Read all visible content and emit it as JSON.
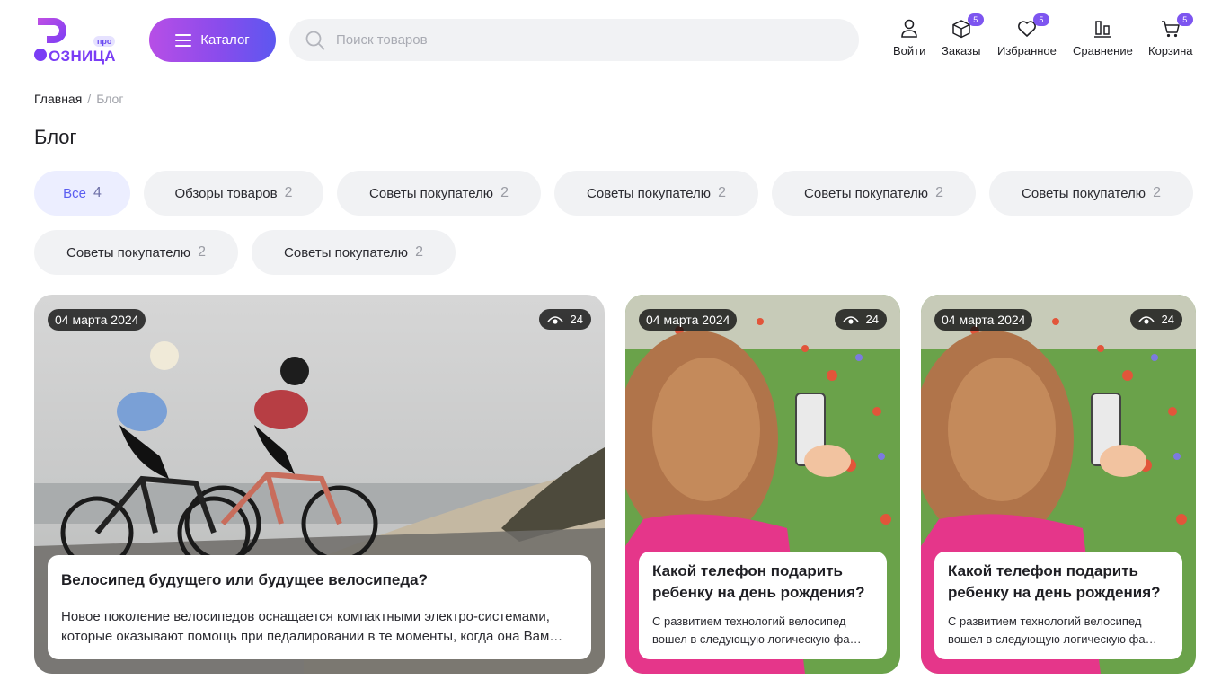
{
  "header": {
    "logo": {
      "badge": "про",
      "text": "ОЗНИЦА"
    },
    "catalog_label": "Каталог",
    "search_placeholder": "Поиск товаров",
    "nav": [
      {
        "label": "Войти",
        "icon": "user-icon"
      },
      {
        "label": "Заказы",
        "icon": "box-icon",
        "badge": "5"
      },
      {
        "label": "Избранное",
        "icon": "heart-icon",
        "badge": "5"
      },
      {
        "label": "Сравнение",
        "icon": "compare-icon"
      },
      {
        "label": "Корзина",
        "icon": "cart-icon",
        "badge": "5"
      }
    ]
  },
  "breadcrumb": {
    "home": "Главная",
    "separator": "/",
    "current": "Блог"
  },
  "page_title": "Блог",
  "filters": [
    {
      "label": "Все",
      "count": "4",
      "active": true
    },
    {
      "label": "Обзоры товаров",
      "count": "2"
    },
    {
      "label": "Советы покупателю",
      "count": "2"
    },
    {
      "label": "Советы покупателю",
      "count": "2"
    },
    {
      "label": "Советы покупателю",
      "count": "2"
    },
    {
      "label": "Советы покупателю",
      "count": "2"
    },
    {
      "label": "Советы покупателю",
      "count": "2"
    },
    {
      "label": "Советы покупателю",
      "count": "2"
    }
  ],
  "posts": [
    {
      "date": "04 марта 2024",
      "views": "24",
      "title": "Велосипед будущего или будущее велосипеда?",
      "excerpt_1": "Новое поколение велосипедов оснащается компактными электро-системами,",
      "excerpt_2": "которые оказывают помощь при педалировании в те моменты, когда она Вам…",
      "image": "cyclists-photo"
    },
    {
      "date": "04 марта 2024",
      "views": "24",
      "title_1": "Какой телефон подарить",
      "title_2": "ребенку на день рождения?",
      "excerpt_1": "С развитием технологий велосипед",
      "excerpt_2": " вошел в следующую логическую фа…",
      "image": "girl-with-phone-photo"
    },
    {
      "date": "04 марта 2024",
      "views": "24",
      "title_1": "Какой телефон подарить",
      "title_2": "ребенку на день рождения?",
      "excerpt_1": "С развитием технологий велосипед",
      "excerpt_2": " вошел в следующую логическую фа…",
      "image": "girl-with-phone-photo"
    }
  ],
  "colors": {
    "accent": "#7d55f0",
    "chip_bg": "#f1f2f4",
    "chip_active_bg": "#eceeff"
  }
}
